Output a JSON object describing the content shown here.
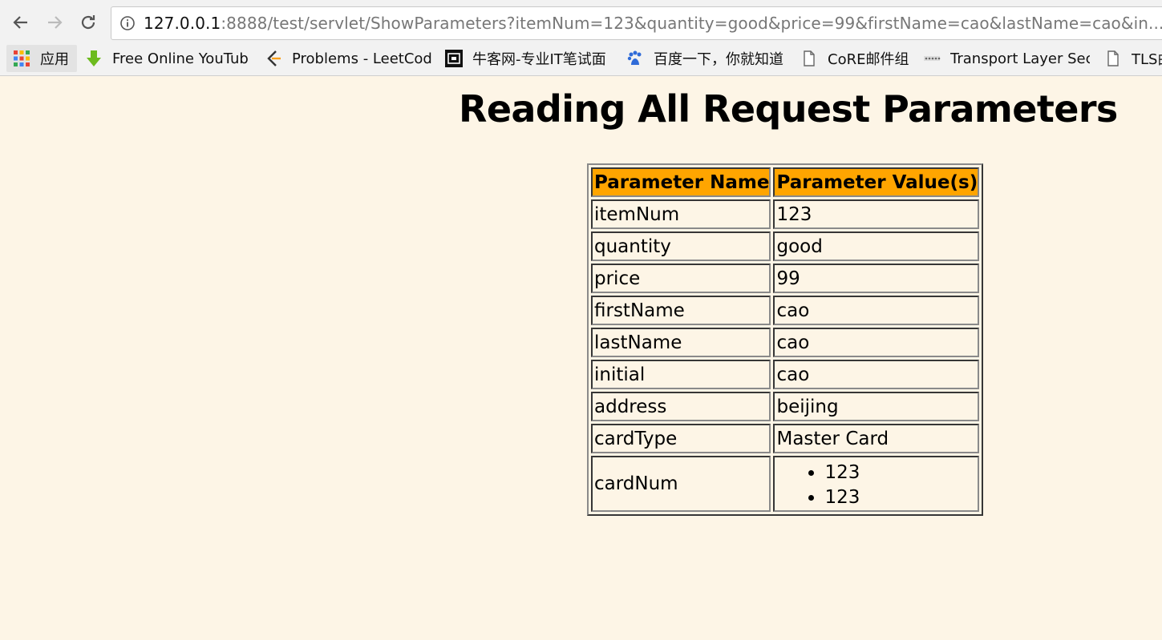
{
  "browser": {
    "url_host": "127.0.0.1",
    "url_rest": ":8888/test/servlet/ShowParameters?itemNum=123&quantity=good&price=99&firstName=cao&lastName=cao&in...",
    "bookmarks": [
      {
        "label": "应用",
        "icon": "apps-grid-icon"
      },
      {
        "label": "Free Online YouTub",
        "icon": "download-arrow-icon"
      },
      {
        "label": "Problems - LeetCod",
        "icon": "leetcode-icon"
      },
      {
        "label": "牛客网-专业IT笔试面",
        "icon": "nowcoder-icon"
      },
      {
        "label": "百度一下，你就知道",
        "icon": "baidu-paw-icon"
      },
      {
        "label": "CoRE邮件组",
        "icon": "page-icon"
      },
      {
        "label": "Transport Layer Sec",
        "icon": "dotted-icon"
      },
      {
        "label": "TLS曲",
        "icon": "page-icon"
      }
    ]
  },
  "page": {
    "title": "Reading All Request Parameters",
    "table": {
      "headers": [
        "Parameter Name",
        "Parameter Value(s)"
      ],
      "rows": [
        {
          "name": "itemNum",
          "value": "123"
        },
        {
          "name": "quantity",
          "value": "good"
        },
        {
          "name": "price",
          "value": "99"
        },
        {
          "name": "firstName",
          "value": "cao"
        },
        {
          "name": "lastName",
          "value": "cao"
        },
        {
          "name": "initial",
          "value": "cao"
        },
        {
          "name": "address",
          "value": "beijing"
        },
        {
          "name": "cardType",
          "value": "Master Card"
        },
        {
          "name": "cardNum",
          "values": [
            "123",
            "123"
          ]
        }
      ]
    }
  },
  "colors": {
    "page_background": "#fdf5e6",
    "header_background": "#ffa500"
  }
}
